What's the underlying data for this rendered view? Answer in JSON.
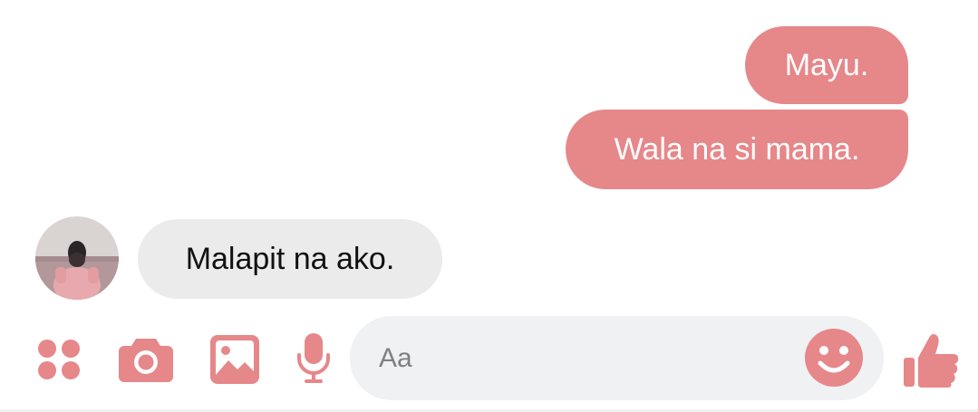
{
  "colors": {
    "accent": "#e6878a",
    "incoming_bubble": "#ebebeb",
    "input_background": "#f0f1f3",
    "placeholder": "#808080"
  },
  "messages": [
    {
      "direction": "outgoing",
      "text": "Mayu."
    },
    {
      "direction": "outgoing",
      "text": "Wala na si mama."
    },
    {
      "direction": "incoming",
      "text": "Malapit na ako."
    }
  ],
  "composer": {
    "icons": [
      "apps-icon",
      "camera-icon",
      "gallery-icon",
      "microphone-icon",
      "emoji-icon",
      "thumbs-up-icon"
    ],
    "placeholder": "Aa"
  }
}
